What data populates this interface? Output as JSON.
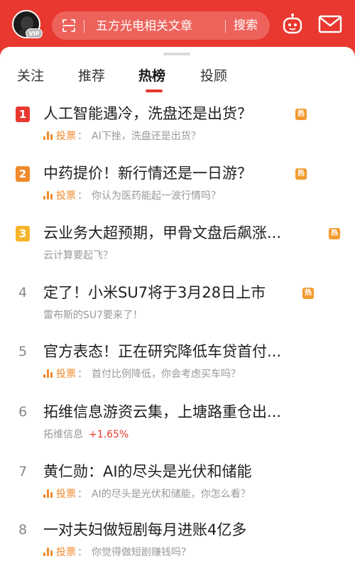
{
  "header": {
    "vip_badge": "VIP",
    "search_placeholder": "五方光电相关文章",
    "search_button": "搜索",
    "accent_color": "#e8382f"
  },
  "tabs": [
    {
      "label": "关注"
    },
    {
      "label": "推荐"
    },
    {
      "label": "热榜",
      "active": true
    },
    {
      "label": "投顾"
    }
  ],
  "hot_badge": "热",
  "vote_label": "投票",
  "items": [
    {
      "rank": "1",
      "rank_color": "#e8382f",
      "title": "人工智能遇冷，洗盘还是出货？",
      "hot": true,
      "vote": true,
      "subtitle": "AI下挫，洗盘还是出货？"
    },
    {
      "rank": "2",
      "rank_color": "#f08a2c",
      "title": "中药提价！新行情还是一日游？",
      "hot": true,
      "vote": true,
      "subtitle": "你认为医药能起一波行情吗？"
    },
    {
      "rank": "3",
      "rank_color": "#f6b52c",
      "title": "云业务大超预期，甲骨文盘后飙涨...",
      "hot": true,
      "vote": false,
      "subtitle": "云计算要起飞？"
    },
    {
      "rank": "4",
      "title": "定了！小米SU7将于3月28日上市",
      "hot": true,
      "vote": false,
      "subtitle": "雷布斯的SU7要来了！"
    },
    {
      "rank": "5",
      "title": "官方表态！正在研究降低车贷首付...",
      "hot": false,
      "vote": true,
      "subtitle": "首付比例降低，你会考虑买车吗？"
    },
    {
      "rank": "6",
      "title": "拓维信息游资云集，上塘路重仓出...",
      "hot": false,
      "vote": false,
      "subtitle": "拓维信息",
      "change": "+1.65%"
    },
    {
      "rank": "7",
      "title": "黄仁勋：AI的尽头是光伏和储能",
      "hot": false,
      "vote": true,
      "subtitle": "AI的尽头是光伏和储能，你怎么看？"
    },
    {
      "rank": "8",
      "title": "一对夫妇做短剧每月进账4亿多",
      "hot": false,
      "vote": true,
      "subtitle": "你觉得做短剧赚钱吗？"
    }
  ]
}
